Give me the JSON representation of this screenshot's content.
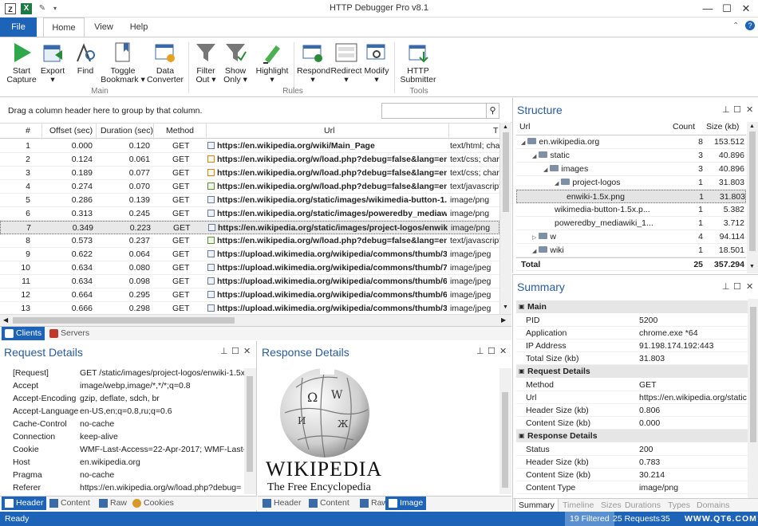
{
  "app": {
    "title": "HTTP Debugger Pro v8.1"
  },
  "menu_tabs": [
    "File",
    "Home",
    "View",
    "Help"
  ],
  "ribbon": {
    "buttons": [
      {
        "label1": "Start",
        "label2": "Capture",
        "icon": "play-icon"
      },
      {
        "label1": "Export",
        "label2": "▾",
        "icon": "export-icon"
      },
      {
        "label1": "Find",
        "label2": "",
        "icon": "find-icon"
      },
      {
        "label1": "Toggle",
        "label2": "Bookmark ▾",
        "icon": "bookmark-icon"
      },
      {
        "label1": "Data",
        "label2": "Converter",
        "icon": "converter-icon"
      },
      {
        "label1": "Filter",
        "label2": "Out ▾",
        "icon": "filter-icon"
      },
      {
        "label1": "Show",
        "label2": "Only ▾",
        "icon": "filter-icon"
      },
      {
        "label1": "Highlight",
        "label2": "▾",
        "icon": "highlight-icon"
      },
      {
        "label1": "Respond",
        "label2": "▾",
        "icon": "respond-icon"
      },
      {
        "label1": "Redirect",
        "label2": "▾",
        "icon": "redirect-icon"
      },
      {
        "label1": "Modify",
        "label2": "▾",
        "icon": "modify-icon"
      },
      {
        "label1": "HTTP",
        "label2": "Submitter",
        "icon": "submitter-icon"
      }
    ],
    "groups": [
      "Main",
      "Rules",
      "Tools"
    ]
  },
  "grid": {
    "group_hint": "Drag a column header here to group by that column.",
    "columns": [
      "#",
      "Offset (sec)",
      "Duration (sec)",
      "Method",
      "Url",
      "T"
    ],
    "rows": [
      {
        "n": "1",
        "offset": "0.000",
        "dur": "0.120",
        "method": "GET",
        "url": "https://en.wikipedia.org/wiki/Main_Page",
        "type": "text/html; cha",
        "kind": "html"
      },
      {
        "n": "2",
        "offset": "0.124",
        "dur": "0.061",
        "method": "GET",
        "url": "https://en.wikipedia.org/w/load.php?debug=false&lang=en...",
        "type": "text/css; chars",
        "kind": "css"
      },
      {
        "n": "3",
        "offset": "0.189",
        "dur": "0.077",
        "method": "GET",
        "url": "https://en.wikipedia.org/w/load.php?debug=false&lang=en...",
        "type": "text/css; chars",
        "kind": "css"
      },
      {
        "n": "4",
        "offset": "0.274",
        "dur": "0.070",
        "method": "GET",
        "url": "https://en.wikipedia.org/w/load.php?debug=false&lang=en...",
        "type": "text/javascript",
        "kind": "js"
      },
      {
        "n": "5",
        "offset": "0.286",
        "dur": "0.139",
        "method": "GET",
        "url": "https://en.wikipedia.org/static/images/wikimedia-button-1...",
        "type": "image/png",
        "kind": "img"
      },
      {
        "n": "6",
        "offset": "0.313",
        "dur": "0.245",
        "method": "GET",
        "url": "https://en.wikipedia.org/static/images/poweredby_mediawi...",
        "type": "image/png",
        "kind": "img"
      },
      {
        "n": "7",
        "offset": "0.349",
        "dur": "0.223",
        "method": "GET",
        "url": "https://en.wikipedia.org/static/images/project-logos/enwiki...",
        "type": "image/png",
        "kind": "img"
      },
      {
        "n": "8",
        "offset": "0.573",
        "dur": "0.237",
        "method": "GET",
        "url": "https://en.wikipedia.org/w/load.php?debug=false&lang=en...",
        "type": "text/javascript",
        "kind": "js"
      },
      {
        "n": "9",
        "offset": "0.622",
        "dur": "0.064",
        "method": "GET",
        "url": "https://upload.wikimedia.org/wikipedia/commons/thumb/3...",
        "type": "image/jpeg",
        "kind": "img"
      },
      {
        "n": "10",
        "offset": "0.634",
        "dur": "0.080",
        "method": "GET",
        "url": "https://upload.wikimedia.org/wikipedia/commons/thumb/7...",
        "type": "image/jpeg",
        "kind": "img"
      },
      {
        "n": "11",
        "offset": "0.634",
        "dur": "0.098",
        "method": "GET",
        "url": "https://upload.wikimedia.org/wikipedia/commons/thumb/6...",
        "type": "image/jpeg",
        "kind": "img"
      },
      {
        "n": "12",
        "offset": "0.664",
        "dur": "0.295",
        "method": "GET",
        "url": "https://upload.wikimedia.org/wikipedia/commons/thumb/6...",
        "type": "image/jpeg",
        "kind": "img"
      },
      {
        "n": "13",
        "offset": "0.666",
        "dur": "0.298",
        "method": "GET",
        "url": "https://upload.wikimedia.org/wikipedia/commons/thumb/3...",
        "type": "image/jpeg",
        "kind": "img"
      }
    ],
    "selected_row": 7
  },
  "client_tabs": [
    "Clients",
    "Servers"
  ],
  "request": {
    "title": "Request Details",
    "rows": [
      {
        "k": "[Request]",
        "v": "GET /static/images/project-logos/enwiki-1.5x"
      },
      {
        "k": "Accept",
        "v": "image/webp,image/*,*/*;q=0.8"
      },
      {
        "k": "Accept-Encoding",
        "v": "gzip, deflate, sdch, br"
      },
      {
        "k": "Accept-Language",
        "v": "en-US,en;q=0.8,ru;q=0.6"
      },
      {
        "k": "Cache-Control",
        "v": "no-cache"
      },
      {
        "k": "Connection",
        "v": "keep-alive"
      },
      {
        "k": "Cookie",
        "v": "WMF-Last-Access=22-Apr-2017; WMF-Last-A"
      },
      {
        "k": "Host",
        "v": "en.wikipedia.org"
      },
      {
        "k": "Pragma",
        "v": "no-cache"
      },
      {
        "k": "Referer",
        "v": "https://en.wikipedia.org/w/load.php?debug="
      }
    ],
    "tabs": [
      "Header",
      "Content",
      "Raw",
      "Cookies"
    ]
  },
  "response": {
    "title": "Response Details",
    "wordmark": "WIKIPEDIA",
    "tagline": "The Free Encyclopedia",
    "tabs": [
      "Header",
      "Content",
      "Raw",
      "Image"
    ]
  },
  "structure": {
    "title": "Structure",
    "columns": [
      "Url",
      "Count",
      "Size (kb)"
    ],
    "rows": [
      {
        "name": "en.wikipedia.org",
        "count": "8",
        "size": "153.512",
        "indent": 0,
        "exp": "◢",
        "folder": true
      },
      {
        "name": "static",
        "count": "3",
        "size": "40.896",
        "indent": 1,
        "exp": "◢",
        "folder": true
      },
      {
        "name": "images",
        "count": "3",
        "size": "40.896",
        "indent": 2,
        "exp": "◢",
        "folder": true
      },
      {
        "name": "project-logos",
        "count": "1",
        "size": "31.803",
        "indent": 3,
        "exp": "◢",
        "folder": true
      },
      {
        "name": "enwiki-1.5x.png",
        "count": "1",
        "size": "31.803",
        "indent": 4,
        "exp": "",
        "folder": false
      },
      {
        "name": "wikimedia-button-1.5x.p...",
        "count": "1",
        "size": "5.382",
        "indent": 3,
        "exp": "",
        "folder": false
      },
      {
        "name": "poweredby_mediawiki_1...",
        "count": "1",
        "size": "3.712",
        "indent": 3,
        "exp": "",
        "folder": false
      },
      {
        "name": "w",
        "count": "4",
        "size": "94.114",
        "indent": 1,
        "exp": "▷",
        "folder": true
      },
      {
        "name": "wiki",
        "count": "1",
        "size": "18.501",
        "indent": 1,
        "exp": "◢",
        "folder": true
      },
      {
        "name": "Total",
        "count": "25",
        "size": "357.294",
        "indent": 0,
        "exp": "",
        "folder": false
      }
    ]
  },
  "summary": {
    "title": "Summary",
    "groups": [
      {
        "name": "Main",
        "props": [
          [
            "PID",
            "5200"
          ],
          [
            "Application",
            "chrome.exe *64"
          ],
          [
            "IP Address",
            "91.198.174.192:443"
          ],
          [
            "Total Size (kb)",
            "31.803"
          ]
        ]
      },
      {
        "name": "Request Details",
        "props": [
          [
            "Method",
            "GET"
          ],
          [
            "Url",
            "https://en.wikipedia.org/static"
          ],
          [
            "Header Size (kb)",
            "0.806"
          ],
          [
            "Content Size (kb)",
            "0.000"
          ]
        ]
      },
      {
        "name": "Response Details",
        "props": [
          [
            "Status",
            "200"
          ],
          [
            "Header Size (kb)",
            "0.783"
          ],
          [
            "Content Size (kb)",
            "30.214"
          ],
          [
            "Content Type",
            "image/png"
          ]
        ]
      }
    ],
    "tabs": [
      "Summary",
      "Timeline",
      "Sizes",
      "Durations",
      "Types",
      "Domains"
    ]
  },
  "status": {
    "ready": "Ready",
    "filtered": "19 Filtered",
    "requests": "25 Requests",
    "extra": "35",
    "watermark": "WWW.QT6.COM"
  },
  "colors": {
    "accent": "#1d63b8",
    "title_blue": "#2a5b9a"
  }
}
